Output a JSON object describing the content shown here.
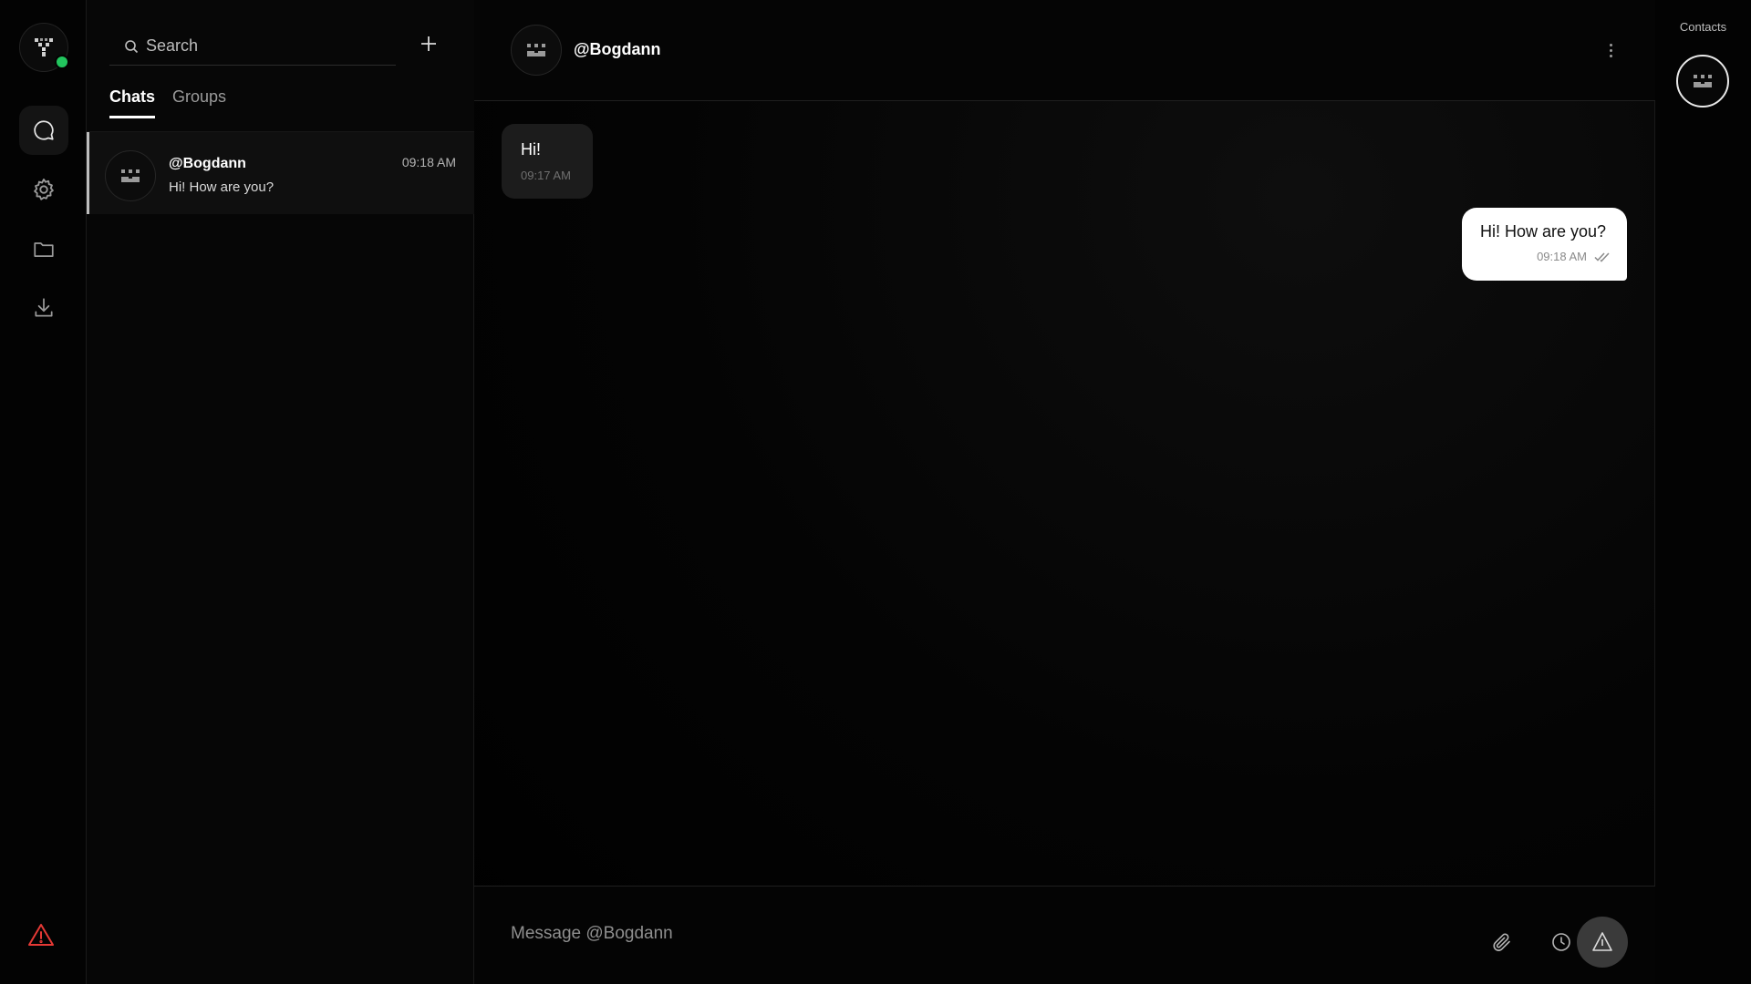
{
  "rail": {
    "logo_icon": "app-logo-icon",
    "status_color": "#22c55e",
    "items": [
      {
        "name": "chats",
        "icon": "chat-bubble-icon",
        "active": true
      },
      {
        "name": "settings",
        "icon": "gear-icon",
        "active": false
      },
      {
        "name": "files",
        "icon": "folder-icon",
        "active": false
      },
      {
        "name": "downloads",
        "icon": "download-icon",
        "active": false
      }
    ],
    "alert_icon": "warning-icon",
    "alert_color": "#e53935"
  },
  "list": {
    "search": {
      "placeholder": "Search"
    },
    "tabs": [
      {
        "label": "Chats",
        "active": true
      },
      {
        "label": "Groups",
        "active": false
      }
    ],
    "chats": [
      {
        "name": "@Bogdann",
        "last_message": "Hi! How are you?",
        "time": "09:18 AM"
      }
    ]
  },
  "conversation": {
    "title": "@Bogdann",
    "messages": [
      {
        "direction": "incoming",
        "text": "Hi!",
        "time": "09:17 AM"
      },
      {
        "direction": "outgoing",
        "text": "Hi! How are you?",
        "time": "09:18 AM",
        "status": "read"
      }
    ],
    "composer": {
      "placeholder": "Message @Bogdann"
    }
  },
  "contacts": {
    "title": "Contacts"
  }
}
